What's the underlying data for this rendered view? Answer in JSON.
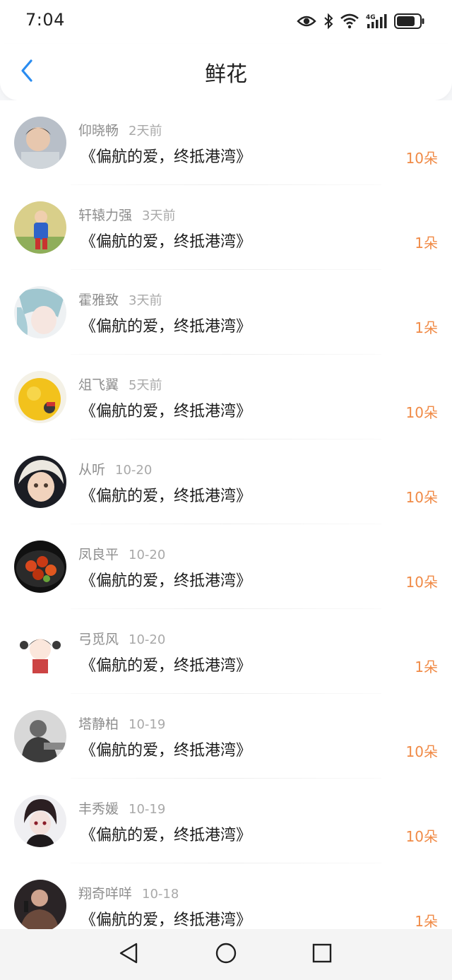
{
  "status_bar": {
    "time": "7:04",
    "network": "4G",
    "icons": [
      "eye-icon",
      "bluetooth-icon",
      "wifi-icon",
      "signal-icon",
      "battery-icon"
    ]
  },
  "header": {
    "title": "鲜花",
    "back_icon": "chevron-left-icon"
  },
  "colors": {
    "accent": "#2a8cf0",
    "count": "#f08a46"
  },
  "rows": [
    {
      "user": "仰晓畅",
      "time": "2天前",
      "book": "《偏航的爱，终抵港湾》",
      "count": "10朵"
    },
    {
      "user": "轩辕力强",
      "time": "3天前",
      "book": "《偏航的爱，终抵港湾》",
      "count": "1朵"
    },
    {
      "user": "霍雅致",
      "time": "3天前",
      "book": "《偏航的爱，终抵港湾》",
      "count": "1朵"
    },
    {
      "user": "俎飞翼",
      "time": "5天前",
      "book": "《偏航的爱，终抵港湾》",
      "count": "10朵"
    },
    {
      "user": "从听",
      "time": "10-20",
      "book": "《偏航的爱，终抵港湾》",
      "count": "10朵"
    },
    {
      "user": "凤良平",
      "time": "10-20",
      "book": "《偏航的爱，终抵港湾》",
      "count": "10朵"
    },
    {
      "user": "弓觅风",
      "time": "10-20",
      "book": "《偏航的爱，终抵港湾》",
      "count": "1朵"
    },
    {
      "user": "塔静柏",
      "time": "10-19",
      "book": "《偏航的爱，终抵港湾》",
      "count": "10朵"
    },
    {
      "user": "丰秀媛",
      "time": "10-19",
      "book": "《偏航的爱，终抵港湾》",
      "count": "10朵"
    },
    {
      "user": "翔奇咩咩",
      "time": "10-18",
      "book": "《偏航的爱，终抵港湾》",
      "count": "1朵"
    }
  ],
  "nav": {
    "items": [
      "back-triangle-icon",
      "home-circle-icon",
      "recents-square-icon"
    ]
  }
}
